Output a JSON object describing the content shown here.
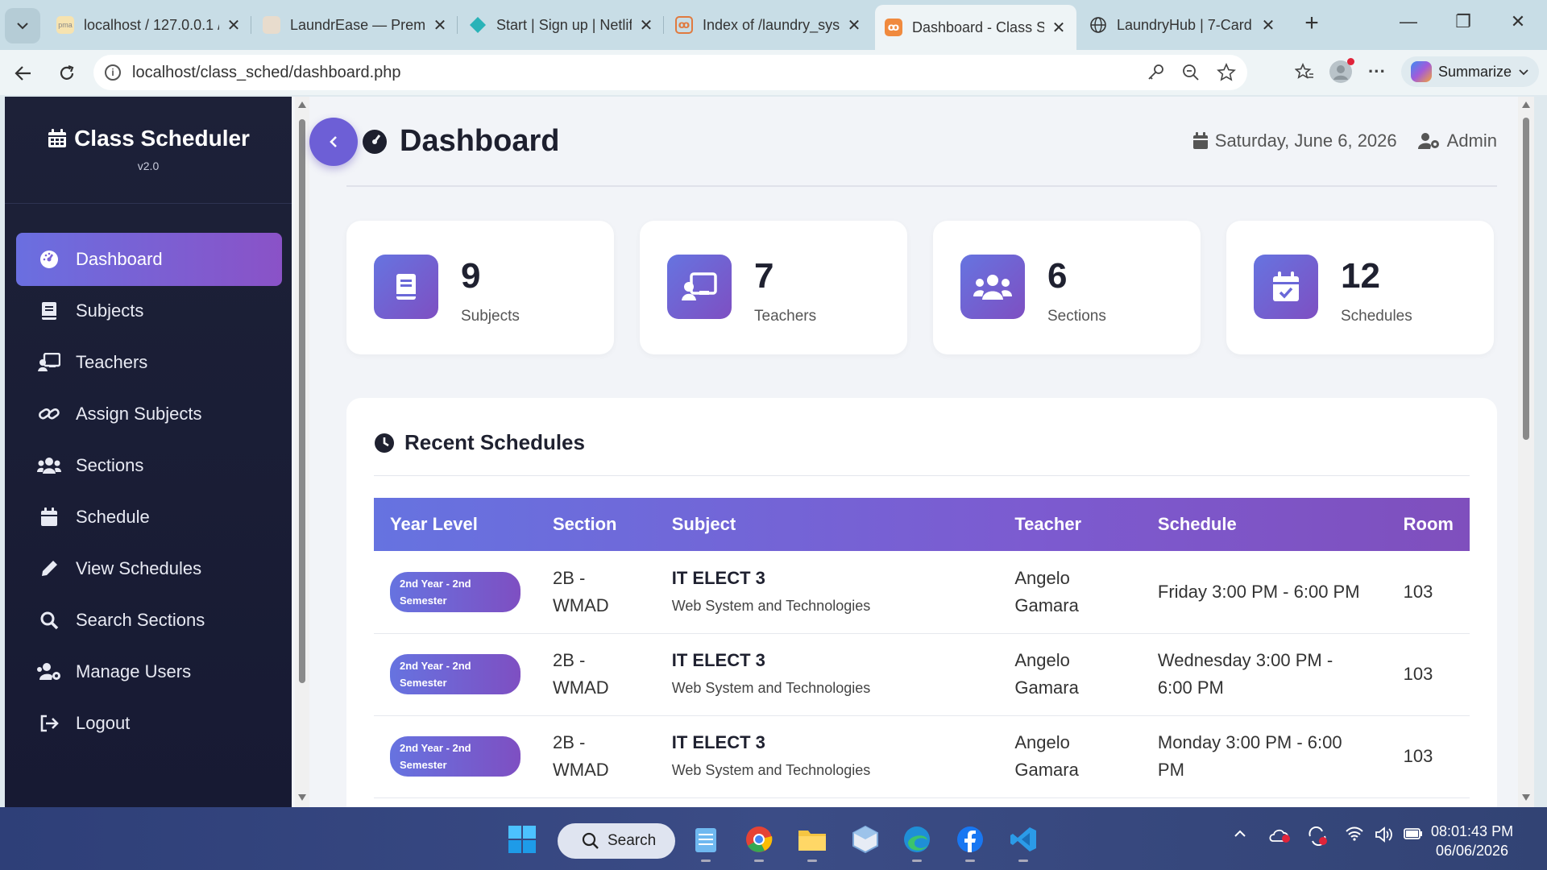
{
  "browser": {
    "tabs": [
      {
        "label": "localhost / 127.0.0.1 / ",
        "favicon": "phpmyadmin-icon"
      },
      {
        "label": "LaundrEase — Premi",
        "favicon": "laundry-icon"
      },
      {
        "label": "Start | Sign up | Netlif",
        "favicon": "netlify-icon"
      },
      {
        "label": "Index of /laundry_sys",
        "favicon": "xampp-icon"
      },
      {
        "label": "Dashboard - Class Sch",
        "favicon": "xampp-icon",
        "active": true
      },
      {
        "label": "LaundryHub | 7-Card",
        "favicon": "globe-icon"
      }
    ],
    "url": "localhost/class_sched/dashboard.php",
    "summarize_label": "Summarize"
  },
  "sidebar": {
    "brand": "Class Scheduler",
    "version": "v2.0",
    "items": [
      {
        "label": "Dashboard",
        "icon": "gauge-icon",
        "active": true
      },
      {
        "label": "Subjects",
        "icon": "book-icon"
      },
      {
        "label": "Teachers",
        "icon": "chalkboard-teacher-icon"
      },
      {
        "label": "Assign Subjects",
        "icon": "link-icon"
      },
      {
        "label": "Sections",
        "icon": "users-icon"
      },
      {
        "label": "Schedule",
        "icon": "calendar-icon"
      },
      {
        "label": "View Schedules",
        "icon": "pencil-icon"
      },
      {
        "label": "Search Sections",
        "icon": "search-icon"
      },
      {
        "label": "Manage Users",
        "icon": "users-cog-icon"
      },
      {
        "label": "Logout",
        "icon": "logout-icon"
      }
    ]
  },
  "header": {
    "title": "Dashboard",
    "date": "Saturday, June 6, 2026",
    "user": "Admin"
  },
  "stats": [
    {
      "value": "9",
      "label": "Subjects",
      "icon": "book-icon"
    },
    {
      "value": "7",
      "label": "Teachers",
      "icon": "chalkboard-teacher-icon"
    },
    {
      "value": "6",
      "label": "Sections",
      "icon": "users-icon"
    },
    {
      "value": "12",
      "label": "Schedules",
      "icon": "calendar-check-icon"
    }
  ],
  "recent": {
    "title": "Recent Schedules",
    "columns": [
      "Year Level",
      "Section",
      "Subject",
      "Teacher",
      "Schedule",
      "Room"
    ],
    "rows": [
      {
        "year_level": "2nd Year - 2nd Semester",
        "section": "2B - WMAD",
        "subject_code": "IT ELECT 3",
        "subject_name": "Web System and Technologies",
        "teacher": "Angelo Gamara",
        "schedule": "Friday 3:00 PM - 6:00 PM",
        "room": "103"
      },
      {
        "year_level": "2nd Year - 2nd Semester",
        "section": "2B - WMAD",
        "subject_code": "IT ELECT 3",
        "subject_name": "Web System and Technologies",
        "teacher": "Angelo Gamara",
        "schedule": "Wednesday 3:00 PM - 6:00 PM",
        "room": "103"
      },
      {
        "year_level": "2nd Year - 2nd Semester",
        "section": "2B - WMAD",
        "subject_code": "IT ELECT 3",
        "subject_name": "Web System and Technologies",
        "teacher": "Angelo Gamara",
        "schedule": "Monday 3:00 PM - 6:00 PM",
        "room": "103"
      }
    ]
  },
  "taskbar": {
    "search_label": "Search",
    "time": "08:01:43 PM",
    "date": "06/06/2026"
  },
  "colors": {
    "accent_start": "#6674e0",
    "accent_end": "#7e4fc2",
    "sidebar_bg": "#1d2138"
  }
}
